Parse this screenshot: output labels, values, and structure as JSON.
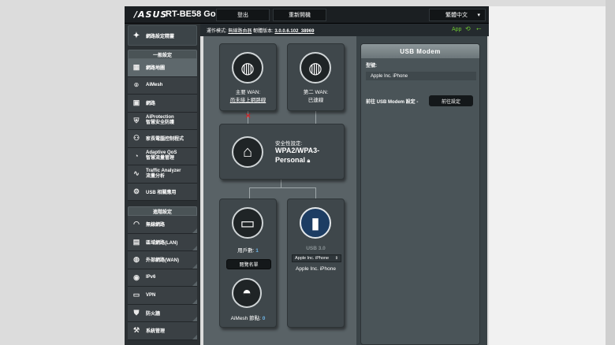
{
  "header": {
    "logo": "/ASUS",
    "model": "RT-BE58 Go",
    "logout": "登出",
    "reboot": "重新開機",
    "language": "繁體中文"
  },
  "status": {
    "mode_label": "運作模式:",
    "mode_value": "無線路由器",
    "fw_label": "韌體版本:",
    "fw_value": "3.0.0.6.102_38969",
    "app": "App"
  },
  "sidebar": {
    "quick_setup": "網路設定精靈",
    "general_title": "一般設定",
    "general": [
      {
        "label": "網路地圖",
        "icon": "network-map-icon",
        "active": true
      },
      {
        "label": "AiMesh",
        "icon": "aimesh-icon"
      },
      {
        "label": "網路",
        "icon": "network-icon"
      },
      {
        "label": "AiProtection",
        "sub": "智慧安全防護",
        "icon": "shield-icon"
      },
      {
        "label": "家長電腦控制程式",
        "icon": "family-icon"
      },
      {
        "label": "Adaptive QoS",
        "sub": "智慧流量管理",
        "icon": "qos-icon"
      },
      {
        "label": "Traffic Analyzer",
        "sub": "流量分析",
        "icon": "analyzer-icon"
      },
      {
        "label": "USB 相關應用",
        "icon": "usb-icon"
      }
    ],
    "advanced_title": "進階設定",
    "advanced": [
      {
        "label": "無線網路",
        "icon": "wifi-icon"
      },
      {
        "label": "區域網路(LAN)",
        "icon": "lan-icon"
      },
      {
        "label": "外部網路(WAN)",
        "icon": "globe-icon"
      },
      {
        "label": "IPv6",
        "icon": "ipv6-icon"
      },
      {
        "label": "VPN",
        "icon": "vpn-icon"
      },
      {
        "label": "防火牆",
        "icon": "firewall-icon"
      },
      {
        "label": "系統管理",
        "icon": "admin-icon"
      }
    ]
  },
  "map": {
    "wan1_label": "主要 WAN:",
    "wan1_status": "尚未接上網路線",
    "wan2_label": "第二 WAN:",
    "wan2_status": "已連線",
    "security_label": "安全性設定:",
    "security_value1": "WPA2/WPA3-",
    "security_value2": "Personal",
    "clients_label": "用戶數:",
    "clients_count": "1",
    "clients_button": "閱覽名單",
    "aimesh_label": "AiMesh 節點:",
    "aimesh_count": "0",
    "usb_label": "USB 3.0",
    "usb_select": "Apple Inc. iPhone",
    "usb_device": "Apple Inc. iPhone"
  },
  "usb_panel": {
    "title": "USB Modem",
    "model_label": "型號:",
    "model_value": "Apple Inc. iPhone",
    "goto_label": "前往 USB Modem 設定 -",
    "goto_button": "前往設定"
  }
}
